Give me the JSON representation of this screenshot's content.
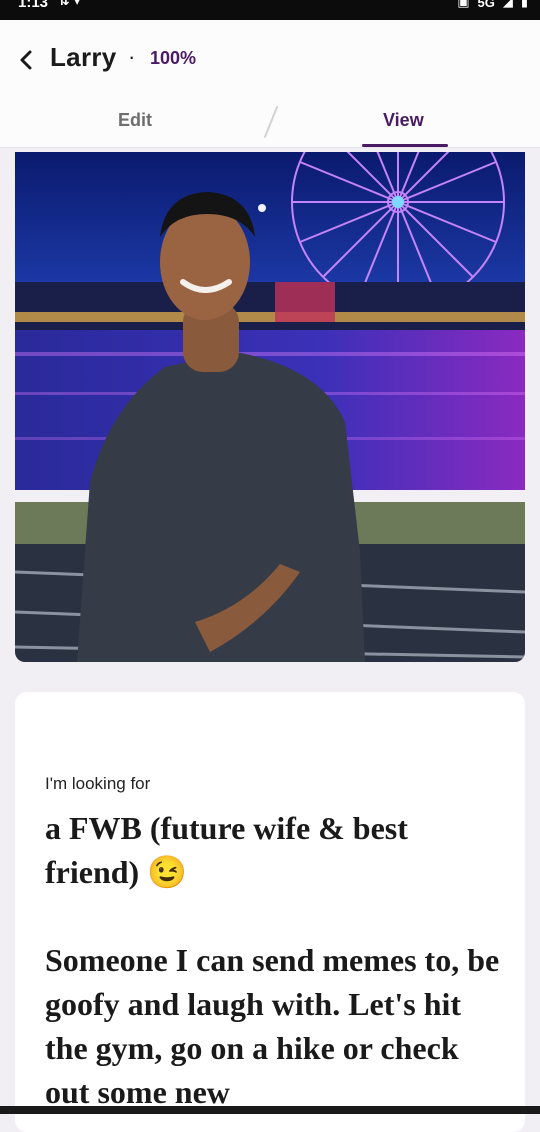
{
  "status_bar": {
    "time": "1:13",
    "network": "5G"
  },
  "header": {
    "back_icon": "chevron-left-icon",
    "name": "Larry",
    "separator": "·",
    "completion": "100%"
  },
  "tabs": [
    {
      "label": "Edit",
      "active": false
    },
    {
      "label": "View",
      "active": true
    }
  ],
  "colors": {
    "accent": "#4a1a64",
    "background": "#f1eff3",
    "card": "#ffffff"
  },
  "prompt_card": {
    "prompt": "I'm looking for",
    "answer": "a FWB (future wife & best friend) 😉\n\nSomeone I can send memes to, be goofy and laugh with. Let's hit the gym, go on a hike or check out some new"
  }
}
